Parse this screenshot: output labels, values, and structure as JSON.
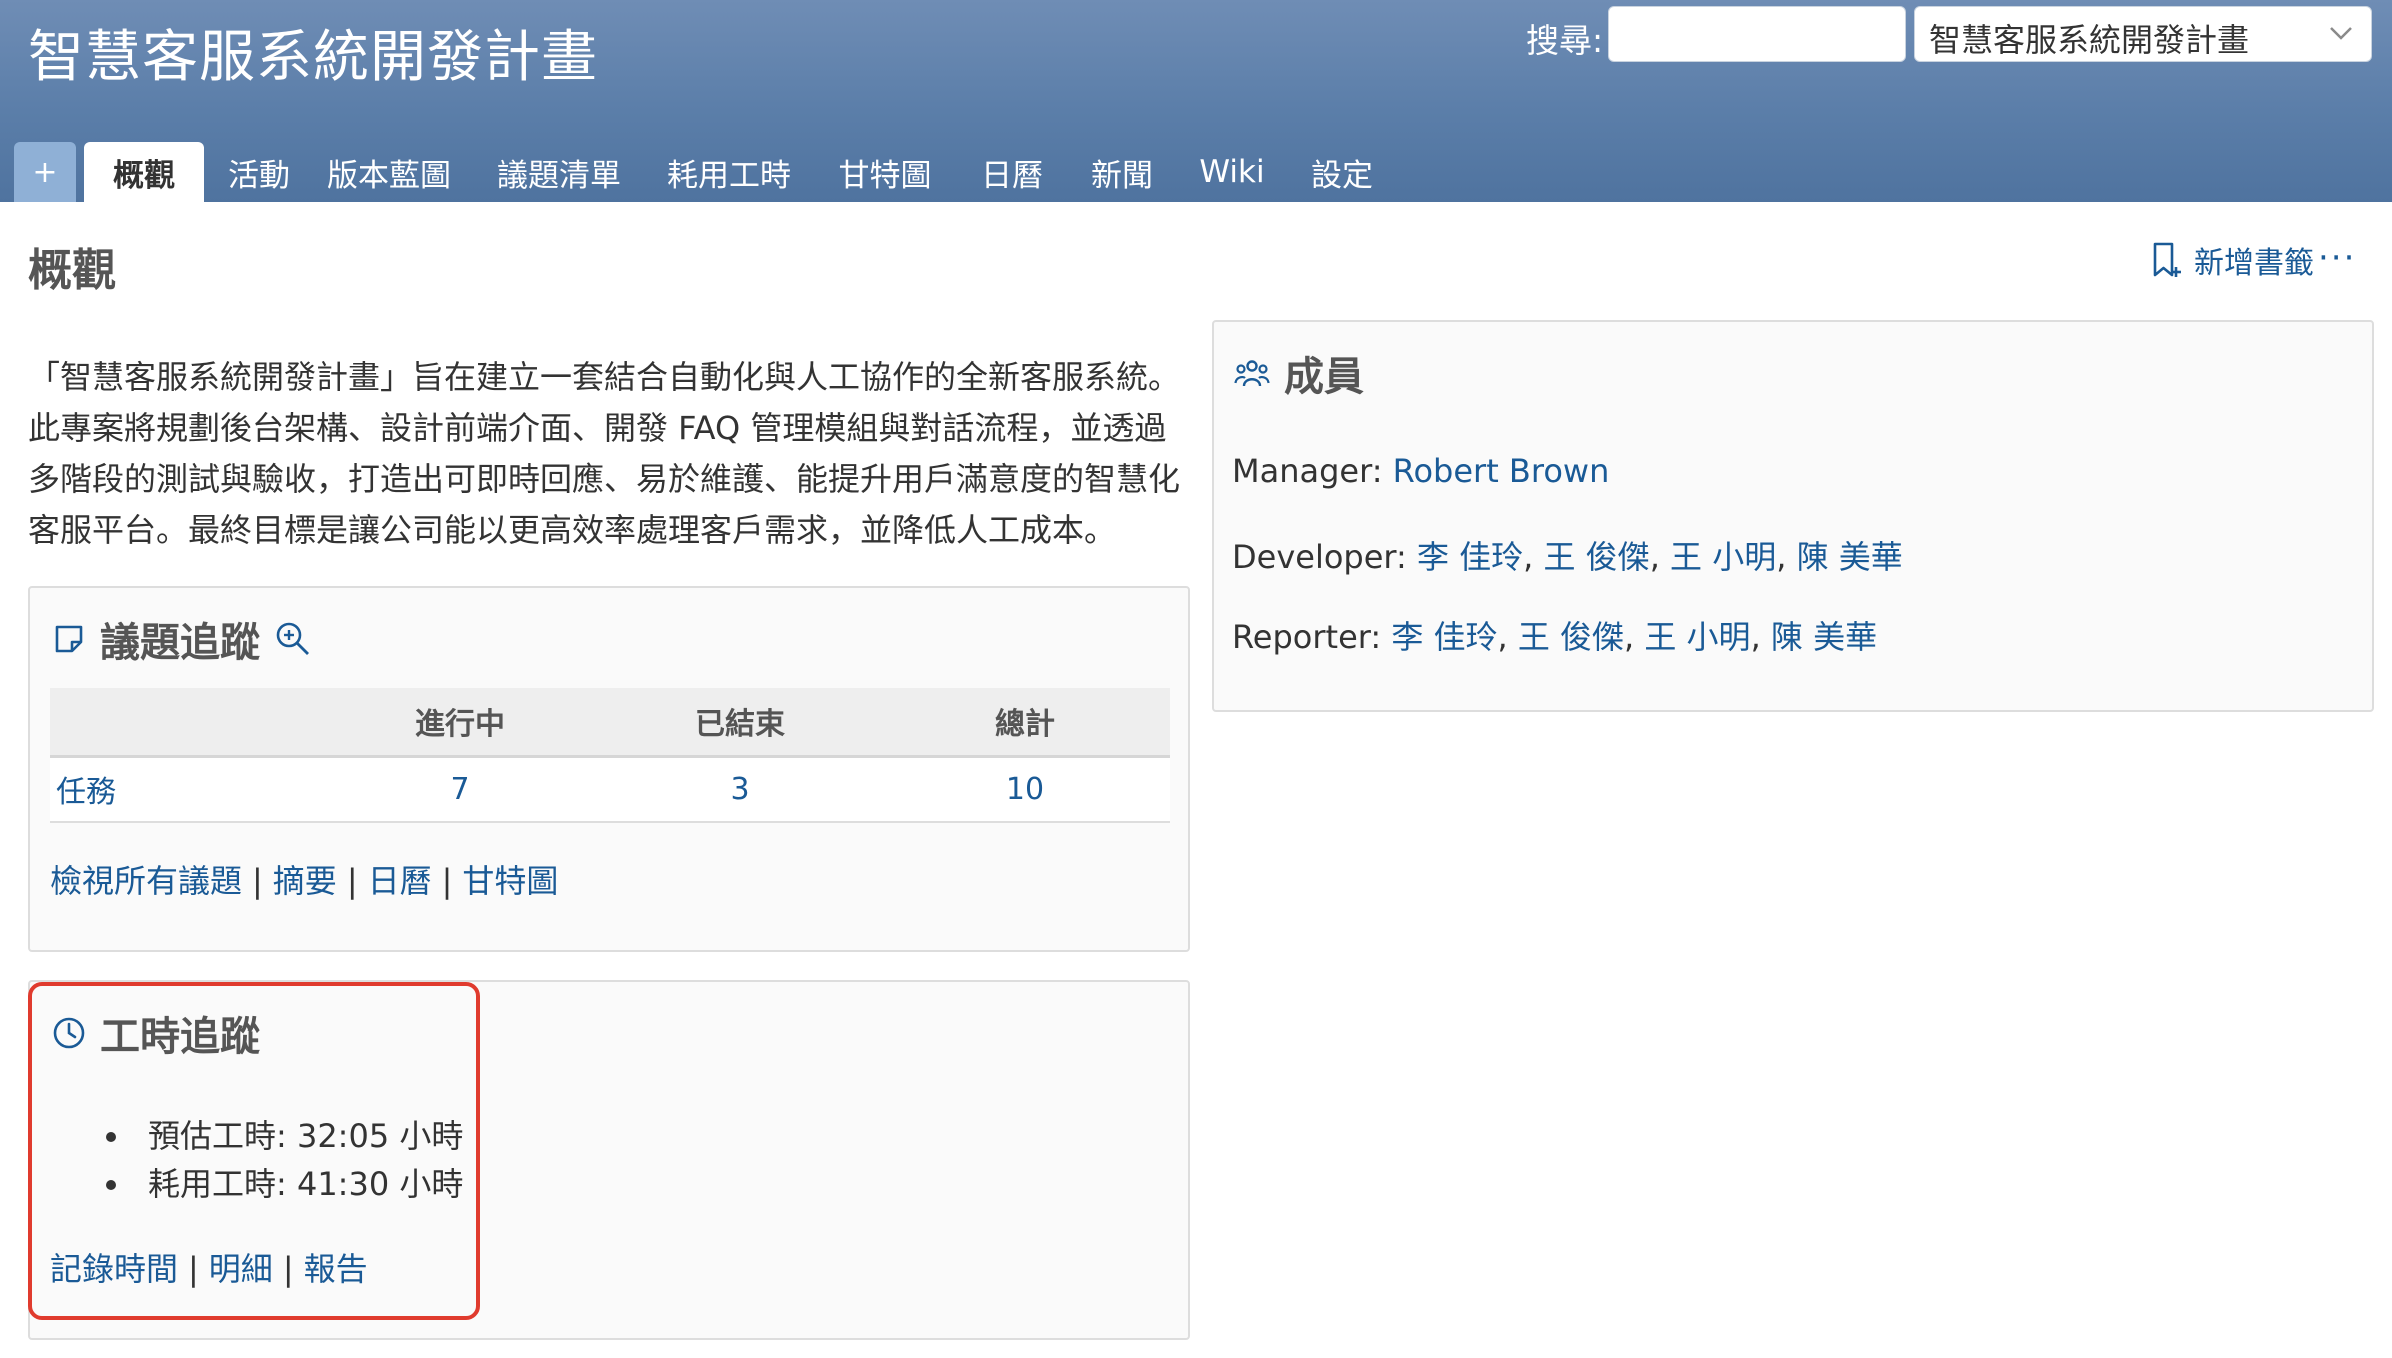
{
  "header": {
    "app_title": "智慧客服系統開發計畫",
    "search_label": "搜尋:",
    "search_value": "",
    "project_select": "智慧客服系統開發計畫"
  },
  "tabs": {
    "plus": "+",
    "items": [
      "概觀",
      "活動",
      "版本藍圖",
      "議題清單",
      "耗用工時",
      "甘特圖",
      "日曆",
      "新聞",
      "Wiki",
      "設定"
    ],
    "active": "概觀"
  },
  "page": {
    "title": "概觀",
    "bookmark_label": "新增書籤",
    "more": "···"
  },
  "description": {
    "lines": [
      "「智慧客服系統開發計畫」旨在建立一套結合自動化與人工協作的全新客服系統。",
      "此專案將規劃後台架構、設計前端介面、開發 FAQ 管理模組與對話流程，並透過",
      "多階段的測試與驗收，打造出可即時回應、易於維護、能提升用戶滿意度的智慧化",
      "客服平台。最終目標是讓公司能以更高效率處理客戶需求，並降低人工成本。"
    ]
  },
  "issues": {
    "title": "議題追蹤",
    "headers": [
      "",
      "進行中",
      "已結束",
      "總計"
    ],
    "rows": [
      {
        "tracker": "任務",
        "open": "7",
        "closed": "3",
        "total": "10"
      }
    ],
    "links": [
      "檢視所有議題",
      "摘要",
      "日曆",
      "甘特圖"
    ],
    "separator": "|"
  },
  "time": {
    "title": "工時追蹤",
    "estimated": "預估工時: 32:05 小時",
    "spent": "耗用工時: 41:30 小時",
    "links": [
      "記錄時間",
      "明細",
      "報告"
    ],
    "separator": "|"
  },
  "members": {
    "title": "成員",
    "manager_label": "Manager:",
    "managers": [
      "Robert Brown"
    ],
    "developer_label": "Developer:",
    "developers": [
      "李 佳玲",
      "王 俊傑",
      "王 小明",
      "陳 美華"
    ],
    "reporter_label": "Reporter:",
    "reporters": [
      "李 佳玲",
      "王 俊傑",
      "王 小明",
      "陳 美華"
    ],
    "comma": ","
  },
  "colors": {
    "header_top": "#6f8db5",
    "header_bottom": "#4f739f",
    "link": "#1a5a96",
    "highlight": "#e03b2e"
  }
}
